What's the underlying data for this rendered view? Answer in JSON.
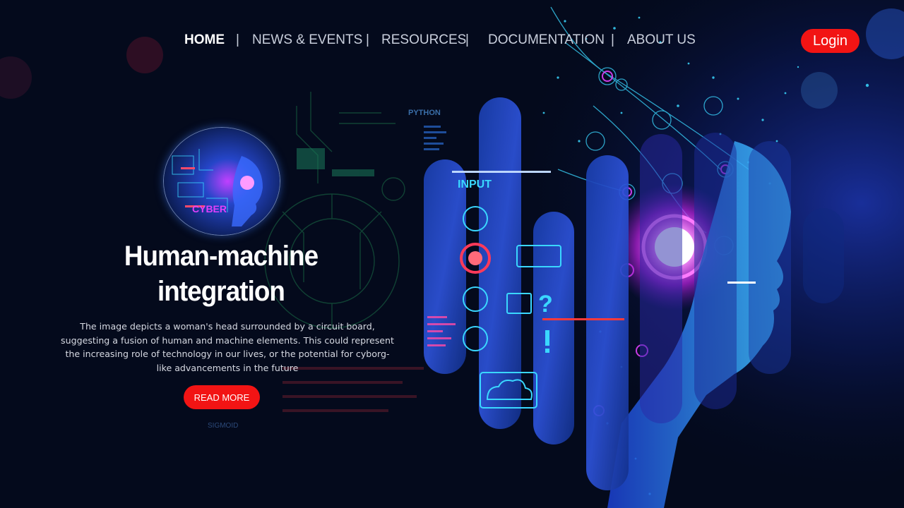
{
  "nav": {
    "items": [
      {
        "label": "HOME",
        "active": true
      },
      {
        "label": "NEWS & EVENTS",
        "active": false
      },
      {
        "label": "RESOURCES",
        "active": false
      },
      {
        "label": "DOCUMENTATION",
        "active": false
      },
      {
        "label": "ABOUT US",
        "active": false
      }
    ],
    "separator": "|"
  },
  "header": {
    "login_label": "Login"
  },
  "hero": {
    "title": "Human-machine integration",
    "description": "The image depicts a woman's head surrounded by a circuit board, suggesting a fusion of human and machine elements. This could represent the increasing role of technology in our lives, or the potential for cyborg-like advancements in the future",
    "cta_label": "READ MORE"
  },
  "artwork": {
    "labels": {
      "python": "PYTHON",
      "input": "INPUT",
      "cyber": "CYBER",
      "sigmoid": "SIGMOID"
    }
  },
  "colors": {
    "background": "#040a1c",
    "accent_red": "#f21414",
    "neon_magenta": "#e040fb",
    "neon_cyan": "#2ee6ff"
  }
}
